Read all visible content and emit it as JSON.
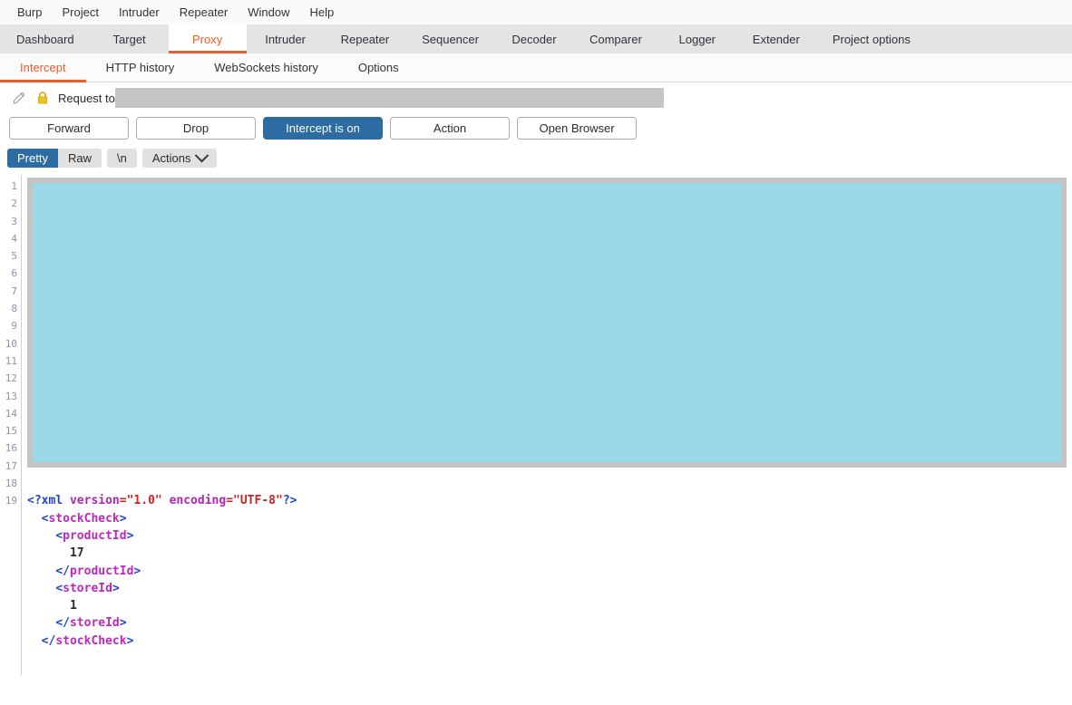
{
  "menubar": {
    "items": [
      {
        "label": "Burp"
      },
      {
        "label": "Project"
      },
      {
        "label": "Intruder"
      },
      {
        "label": "Repeater"
      },
      {
        "label": "Window"
      },
      {
        "label": "Help"
      }
    ]
  },
  "main_tabs": {
    "active": "Proxy",
    "items": [
      {
        "label": "Dashboard"
      },
      {
        "label": "Target"
      },
      {
        "label": "Proxy"
      },
      {
        "label": "Intruder"
      },
      {
        "label": "Repeater"
      },
      {
        "label": "Sequencer"
      },
      {
        "label": "Decoder"
      },
      {
        "label": "Comparer"
      },
      {
        "label": "Logger"
      },
      {
        "label": "Extender"
      },
      {
        "label": "Project options"
      }
    ]
  },
  "sub_tabs": {
    "active": "Intercept",
    "items": [
      {
        "label": "Intercept"
      },
      {
        "label": "HTTP history"
      },
      {
        "label": "WebSockets history"
      },
      {
        "label": "Options"
      }
    ]
  },
  "request_bar": {
    "edit_icon": "pencil-icon",
    "lock_icon": "lock-icon",
    "label": "Request to",
    "host_value": ""
  },
  "actions": {
    "forward": "Forward",
    "drop": "Drop",
    "intercept_toggle": "Intercept is on",
    "action": "Action",
    "open_browser": "Open Browser"
  },
  "editor_toolbar": {
    "pretty": "Pretty",
    "raw": "Raw",
    "newline": "\\n",
    "actions": "Actions",
    "actions_chevron": "chevron-down-icon",
    "selected_view": "Pretty"
  },
  "editor": {
    "line_numbers": [
      1,
      2,
      3,
      4,
      5,
      6,
      7,
      8,
      9,
      10,
      11,
      12,
      13,
      14,
      15,
      16,
      17,
      18,
      19
    ],
    "redacted_lines": "1-17",
    "xml_lines": [
      {
        "indent": 0,
        "tokens": [
          {
            "t": "<?xml ",
            "c": "tok-decl"
          },
          {
            "t": "version",
            "c": "tok-attr"
          },
          {
            "t": "=\"1.0\" ",
            "c": "tok-val"
          },
          {
            "t": "encoding",
            "c": "tok-attr"
          },
          {
            "t": "=\"UTF-8\"",
            "c": "tok-val"
          },
          {
            "t": "?>",
            "c": "tok-decl"
          }
        ]
      },
      {
        "indent": 1,
        "tokens": [
          {
            "t": "<",
            "c": "tok-brk"
          },
          {
            "t": "stockCheck",
            "c": "tok-tag"
          },
          {
            "t": ">",
            "c": "tok-brk"
          }
        ]
      },
      {
        "indent": 2,
        "tokens": [
          {
            "t": "<",
            "c": "tok-brk"
          },
          {
            "t": "productId",
            "c": "tok-tag"
          },
          {
            "t": ">",
            "c": "tok-brk"
          }
        ]
      },
      {
        "indent": 3,
        "tokens": [
          {
            "t": "17",
            "c": "tok-text"
          }
        ]
      },
      {
        "indent": 2,
        "tokens": [
          {
            "t": "</",
            "c": "tok-brk"
          },
          {
            "t": "productId",
            "c": "tok-tag"
          },
          {
            "t": ">",
            "c": "tok-brk"
          }
        ]
      },
      {
        "indent": 2,
        "tokens": [
          {
            "t": "<",
            "c": "tok-brk"
          },
          {
            "t": "storeId",
            "c": "tok-tag"
          },
          {
            "t": ">",
            "c": "tok-brk"
          }
        ]
      },
      {
        "indent": 3,
        "tokens": [
          {
            "t": "1",
            "c": "tok-text"
          }
        ]
      },
      {
        "indent": 2,
        "tokens": [
          {
            "t": "</",
            "c": "tok-brk"
          },
          {
            "t": "storeId",
            "c": "tok-tag"
          },
          {
            "t": ">",
            "c": "tok-brk"
          }
        ]
      },
      {
        "indent": 1,
        "tokens": [
          {
            "t": "</",
            "c": "tok-brk"
          },
          {
            "t": "stockCheck",
            "c": "tok-tag"
          },
          {
            "t": ">",
            "c": "tok-brk"
          }
        ]
      }
    ]
  },
  "colors": {
    "accent_orange": "#f05a28",
    "primary_blue": "#2c6ca3",
    "redaction_fill": "#9bd9e8",
    "redaction_frame": "#c4c4c4",
    "lock_yellow": "#e8b923"
  }
}
